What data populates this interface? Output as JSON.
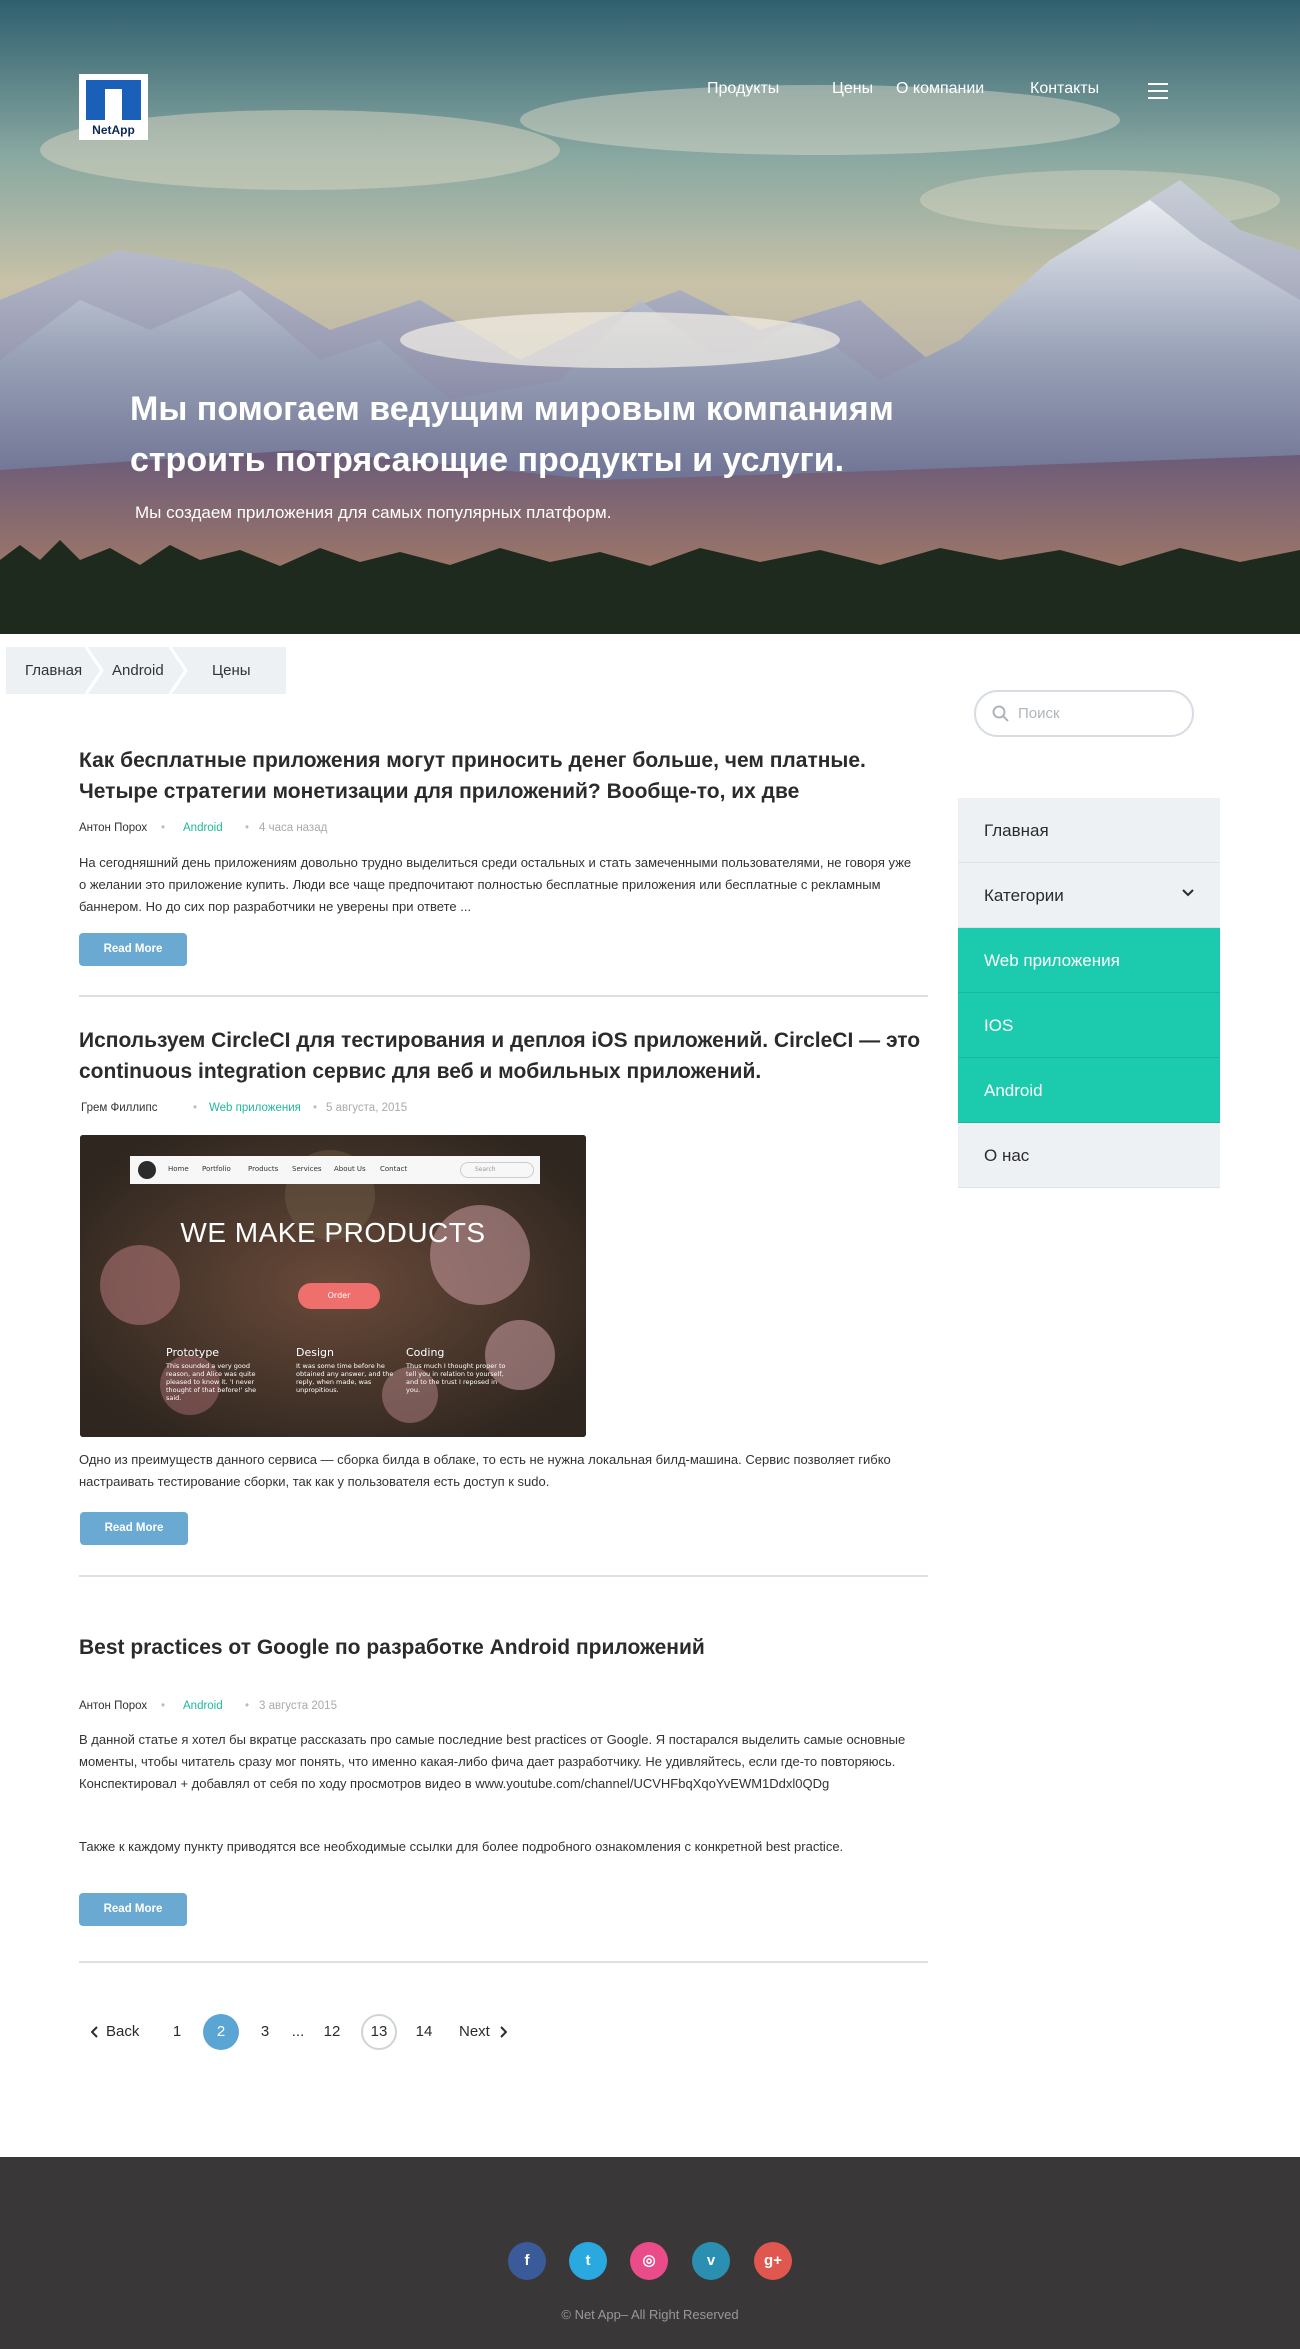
{
  "brand": {
    "logo_text": "NetApp"
  },
  "nav": {
    "items": [
      {
        "label": "Продукты"
      },
      {
        "label": "Цены"
      },
      {
        "label": "О компании"
      },
      {
        "label": "Контакты"
      }
    ],
    "menu_icon": "hamburger-icon"
  },
  "hero": {
    "title": "Мы помогаем ведущим мировым компаниям строить потрясающие продукты и услуги.",
    "subtitle": "Мы создаем приложения для самых популярных платформ."
  },
  "breadcrumb": [
    "Главная",
    "Android",
    "Цены"
  ],
  "posts": [
    {
      "title": "Как бесплатные приложения могут приносить денег больше, чем платные. Четыре стратегии монетизации для приложений? Вообще-то, их две",
      "author": "Антон Порох",
      "category": "Android",
      "date": "4 часа назад",
      "excerpt": "На сегодняшний день приложениям довольно трудно выделиться среди остальных и стать замеченными пользователями, не говоря уже о желании это приложение купить. Люди все чаще предпочитают полностью бесплатные приложения или бесплатные с рекламным баннером. Но до сих пор разработчики не уверены при ответе ...",
      "button": "Read More"
    },
    {
      "title": "Используем CircleCI для тестирования и деплоя iOS приложений. CircleCI — это continuous integration сервис для веб и мобильных приложений.",
      "author": "Грем Филлипс",
      "category": "Web приложения",
      "date": "5 августа, 2015",
      "image": {
        "nav": [
          "Home",
          "Portfolio",
          "Products",
          "Services",
          "About Us",
          "Contact"
        ],
        "search": "Search",
        "headline": "WE MAKE PRODUCTS",
        "order": "Order",
        "columns": [
          {
            "title": "Prototype",
            "text": "This sounded a very good reason, and Alice was quite pleased to know it. 'I never thought of that before!' she said."
          },
          {
            "title": "Design",
            "text": "It was some time before he obtained any answer, and the reply, when made, was unpropitious."
          },
          {
            "title": "Coding",
            "text": "Thus much I thought proper to tell you in relation to yourself, and to the trust I reposed in you."
          }
        ]
      },
      "excerpt": "Одно из преимуществ данного сервиса — сборка билда в облаке, то есть не нужна локальная билд-машина. Сервис позволяет гибко настраивать тестирование сборки, так как у пользователя есть доступ к sudo.",
      "button": "Read More"
    },
    {
      "title": "Best practices от Google по разработке Android приложений",
      "author": "Антон Порох",
      "category": "Android",
      "date": "3 августа 2015",
      "excerpt": "В данной статье я хотел бы вкратце рассказать про самые последние best practices от Google. Я постарался выделить самые основные моменты, чтобы читатель сразу мог понять, что именно какая-либо фича дает разработчику. Не удивляйтесь, если где-то повторяюсь. Конспектировал + добавлял от себя по ходу просмотров видео в www.youtube.com/channel/UCVHFbqXqoYvEWM1Ddxl0QDg",
      "excerpt2": "Также к каждому пункту приводятся все необходимые ссылки для более подробного ознакомления с конкретной best practice.",
      "button": "Read More"
    }
  ],
  "sidebar": {
    "search_placeholder": "Поиск",
    "items": [
      {
        "label": "Главная"
      },
      {
        "label": "Категории"
      },
      {
        "label": "Web приложения"
      },
      {
        "label": "IOS"
      },
      {
        "label": "Android"
      },
      {
        "label": "О нас"
      }
    ]
  },
  "pagination": {
    "back": "Back",
    "next": "Next",
    "pages": [
      "1",
      "2",
      "3",
      "...",
      "12",
      "13",
      "14"
    ],
    "current": "2",
    "highlighted": "13"
  },
  "footer": {
    "social": [
      {
        "icon": "facebook-icon",
        "glyph": "f",
        "color": "#3b5a9a"
      },
      {
        "icon": "twitter-icon",
        "glyph": "t",
        "color": "#2aa9e0"
      },
      {
        "icon": "dribbble-icon",
        "glyph": "◎",
        "color": "#ea4c89"
      },
      {
        "icon": "vimeo-icon",
        "glyph": "v",
        "color": "#2a8fb0"
      },
      {
        "icon": "google-plus-icon",
        "glyph": "g+",
        "color": "#e0574f"
      }
    ],
    "copyright": "© Net App– All Right Reserved"
  },
  "colors": {
    "accent_teal": "#1ccbae",
    "button_blue": "#6aa9d2",
    "page_active": "#5aa5d4",
    "footer_bg": "#3a3738"
  }
}
